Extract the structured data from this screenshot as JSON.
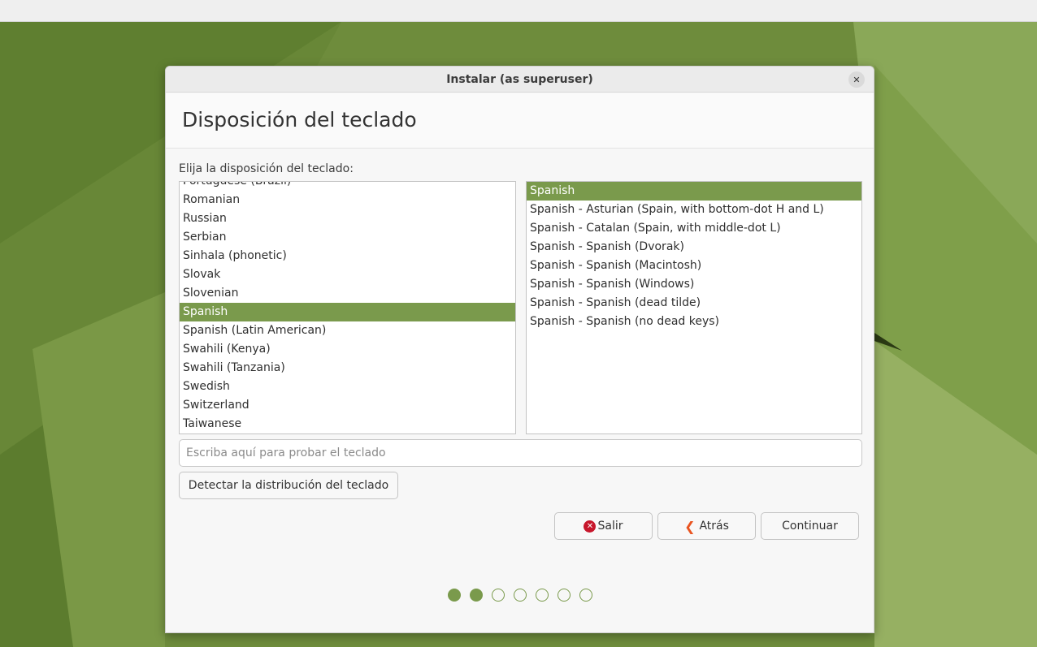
{
  "window": {
    "title": "Instalar (as superuser)",
    "close_glyph": "✕"
  },
  "page": {
    "heading": "Disposición del teclado",
    "prompt": "Elija la disposición del teclado:"
  },
  "layouts": {
    "items": [
      {
        "label": "Portuguese (Brazil)",
        "selected": false
      },
      {
        "label": "Romanian",
        "selected": false
      },
      {
        "label": "Russian",
        "selected": false
      },
      {
        "label": "Serbian",
        "selected": false
      },
      {
        "label": "Sinhala (phonetic)",
        "selected": false
      },
      {
        "label": "Slovak",
        "selected": false
      },
      {
        "label": "Slovenian",
        "selected": false
      },
      {
        "label": "Spanish",
        "selected": true
      },
      {
        "label": "Spanish (Latin American)",
        "selected": false
      },
      {
        "label": "Swahili (Kenya)",
        "selected": false
      },
      {
        "label": "Swahili (Tanzania)",
        "selected": false
      },
      {
        "label": "Swedish",
        "selected": false
      },
      {
        "label": "Switzerland",
        "selected": false
      },
      {
        "label": "Taiwanese",
        "selected": false
      }
    ]
  },
  "variants": {
    "items": [
      {
        "label": "Spanish",
        "selected": true
      },
      {
        "label": "Spanish - Asturian (Spain, with bottom-dot H and L)",
        "selected": false
      },
      {
        "label": "Spanish - Catalan (Spain, with middle-dot L)",
        "selected": false
      },
      {
        "label": "Spanish - Spanish (Dvorak)",
        "selected": false
      },
      {
        "label": "Spanish - Spanish (Macintosh)",
        "selected": false
      },
      {
        "label": "Spanish - Spanish (Windows)",
        "selected": false
      },
      {
        "label": "Spanish - Spanish (dead tilde)",
        "selected": false
      },
      {
        "label": "Spanish - Spanish (no dead keys)",
        "selected": false
      }
    ]
  },
  "test_field": {
    "value": "",
    "placeholder": "Escriba aquí para probar el teclado"
  },
  "buttons": {
    "detect_label": "Detectar la distribución del teclado",
    "quit_label": "Salir",
    "quit_icon_glyph": "✕",
    "back_label": "Atrás",
    "back_icon_glyph": "❮",
    "continue_label": "Continuar"
  },
  "progress": {
    "total_steps": 7,
    "current_step": 2
  },
  "colors": {
    "accent": "#7a9a4c",
    "quit_icon": "#c7162b",
    "back_icon": "#e95420"
  }
}
